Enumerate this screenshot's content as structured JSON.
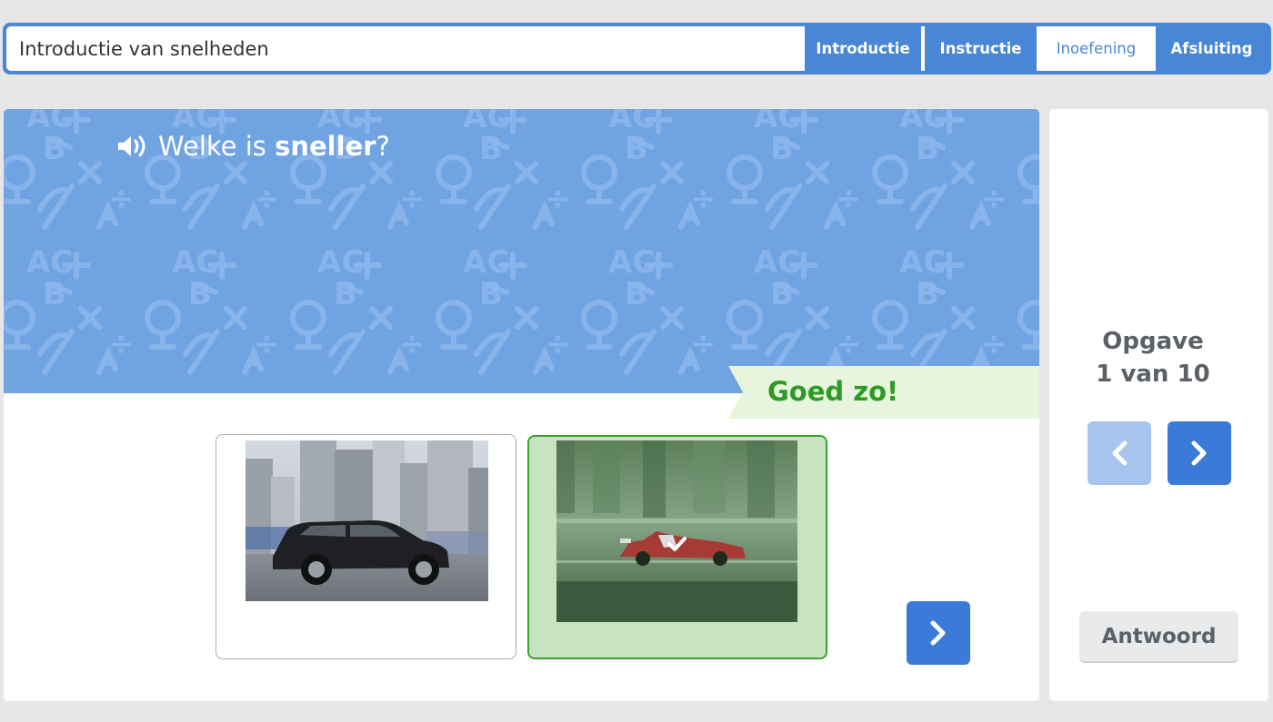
{
  "header": {
    "lesson_title": "Introductie van snelheden",
    "tabs": [
      {
        "label": "Introductie",
        "active": false
      },
      {
        "label": "Instructie",
        "active": false
      },
      {
        "label": "Inoefening",
        "active": true
      },
      {
        "label": "Afsluiting",
        "active": false
      }
    ]
  },
  "question": {
    "prefix": "Welke is ",
    "bold": "sneller",
    "suffix": "?",
    "audio_icon": "speaker-icon"
  },
  "feedback": {
    "text": "Goed zo!",
    "color": "#2e9a26"
  },
  "answers": [
    {
      "image": "black SUV driving with motion blur",
      "selected": false
    },
    {
      "image": "red formula 1 race car with motion blur",
      "selected": true,
      "mark": "checkmark-icon"
    }
  ],
  "progress": {
    "label": "Opgave",
    "counter": "1 van 10",
    "current": 1,
    "total": 10
  },
  "side": {
    "answer_button": "Antwoord"
  },
  "colors": {
    "accent": "#4a86d6",
    "button": "#3b7ad9",
    "button_disabled": "#a7c4ee",
    "banner": "#6fa3e2",
    "correct_border": "#3da12f",
    "correct_bg": "#c7e3c0"
  }
}
